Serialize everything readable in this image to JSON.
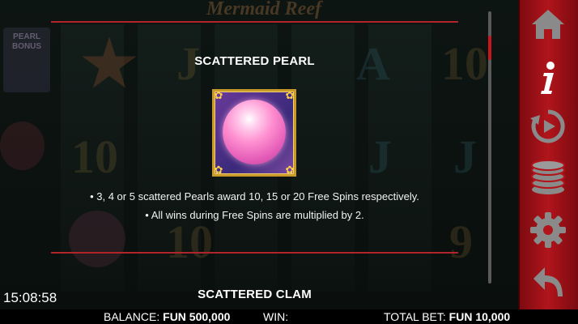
{
  "game": {
    "logo": "Mermaid Reef"
  },
  "background": {
    "bonus_badge": "PEARL BONUS"
  },
  "info_panel": {
    "heading": "SCATTERED PEARL",
    "bullets": [
      "• 3, 4 or 5 scattered Pearls award 10, 15 or 20 Free Spins respectively.",
      "• All wins during Free Spins are multiplied by 2."
    ],
    "next_heading": "SCATTERED CLAM"
  },
  "clock": "15:08:58",
  "status_bar": {
    "balance_label": "BALANCE:",
    "balance_value": "FUN 500,000",
    "win_label": "WIN:",
    "win_value": "",
    "total_bet_label": "TOTAL BET:",
    "total_bet_value": "FUN 10,000"
  },
  "sidebar": {
    "buttons": [
      {
        "icon": "home-icon",
        "active": false
      },
      {
        "icon": "info-icon",
        "active": true
      },
      {
        "icon": "autoplay-icon",
        "active": false
      },
      {
        "icon": "coins-icon",
        "active": false
      },
      {
        "icon": "settings-icon",
        "active": false
      },
      {
        "icon": "back-icon",
        "active": false
      }
    ]
  },
  "colors": {
    "accent_red": "#b0242a",
    "sidebar_red": "#b0151b",
    "icon_grey": "#8a8a8a"
  }
}
